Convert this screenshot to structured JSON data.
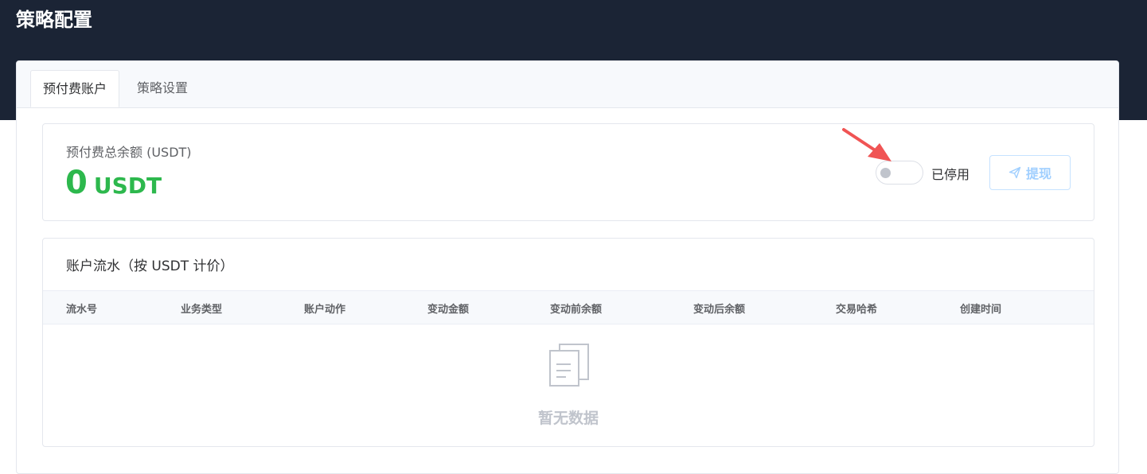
{
  "page": {
    "title": "策略配置"
  },
  "tabs": [
    {
      "label": "预付费账户",
      "active": true
    },
    {
      "label": "策略设置",
      "active": false
    }
  ],
  "balance": {
    "label": "预付费总余额 (USDT)",
    "amount": "0",
    "unit": "USDT"
  },
  "toggle": {
    "state_label": "已停用",
    "enabled": false
  },
  "withdraw": {
    "label": "提现",
    "icon": "send-icon"
  },
  "ledger": {
    "title": "账户流水（按 USDT 计价）",
    "columns": [
      "流水号",
      "业务类型",
      "账户动作",
      "变动金额",
      "变动前余额",
      "变动后余额",
      "交易哈希",
      "创建时间"
    ],
    "rows": [],
    "empty_text": "暂无数据"
  },
  "colors": {
    "header_bg": "#1b2435",
    "balance_green": "#2db84d",
    "annotation_red": "#f05454"
  }
}
